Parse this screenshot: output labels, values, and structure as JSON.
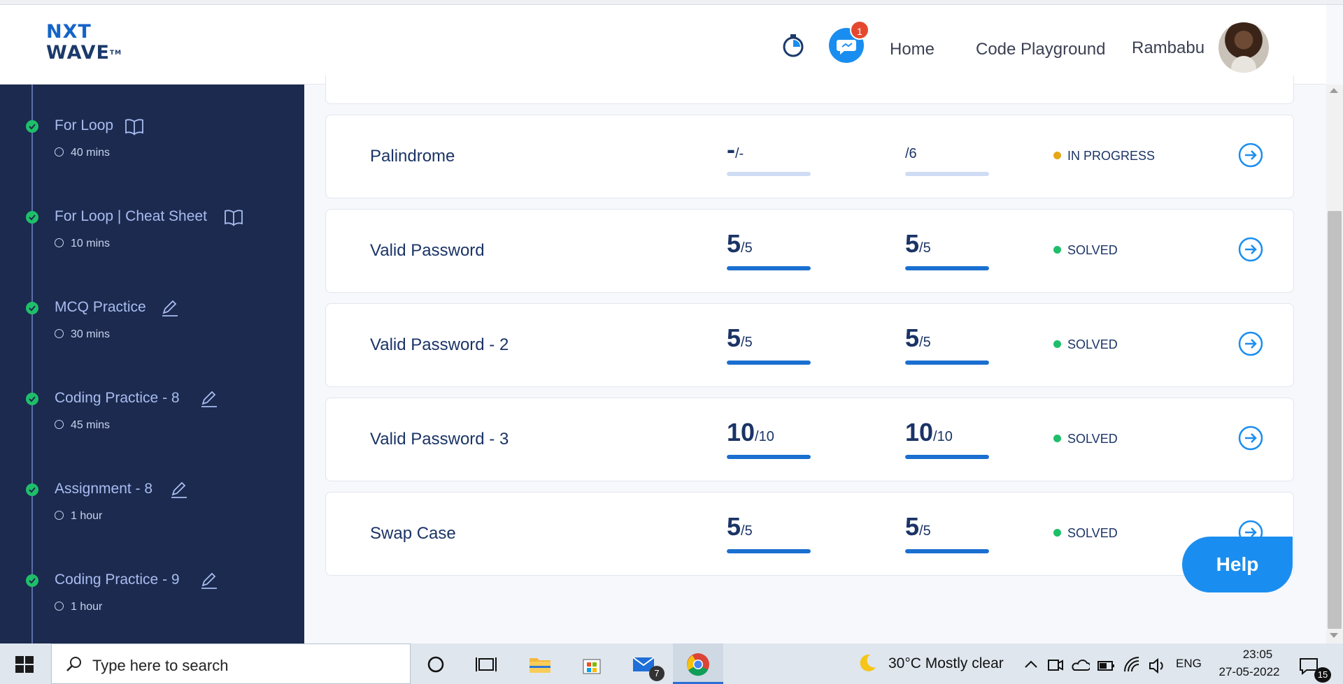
{
  "header": {
    "logo_line1": "NXT",
    "logo_line2": "WAVE",
    "logo_tm": "TM",
    "notification_count": "1",
    "nav_home": "Home",
    "nav_playground": "Code Playground",
    "user_name": "Rambabu"
  },
  "sidebar": {
    "items": [
      {
        "title": "For Loop",
        "duration": "40 mins",
        "icon": "book-icon"
      },
      {
        "title": "For Loop | Cheat Sheet",
        "duration": "10 mins",
        "icon": "book-icon"
      },
      {
        "title": "MCQ Practice",
        "duration": "30 mins",
        "icon": "pencil-icon"
      },
      {
        "title": "Coding Practice - 8",
        "duration": "45 mins",
        "icon": "pencil-icon"
      },
      {
        "title": "Assignment - 8",
        "duration": "1 hour",
        "icon": "pencil-icon"
      },
      {
        "title": "Coding Practice - 9",
        "duration": "1 hour",
        "icon": "pencil-icon"
      }
    ]
  },
  "questions": [
    {
      "title": "Palindrome",
      "score1_big": "-",
      "score1_small": "/-",
      "score1_fill": 0,
      "score2_big": "",
      "score2_small": "/6",
      "score2_fill": 0,
      "status": "IN PROGRESS",
      "status_color": "#e6a817"
    },
    {
      "title": "Valid Password",
      "score1_big": "5",
      "score1_small": "/5",
      "score1_fill": 1,
      "score2_big": "5",
      "score2_small": "/5",
      "score2_fill": 1,
      "status": "SOLVED",
      "status_color": "#1fbf6a"
    },
    {
      "title": "Valid Password - 2",
      "score1_big": "5",
      "score1_small": "/5",
      "score1_fill": 1,
      "score2_big": "5",
      "score2_small": "/5",
      "score2_fill": 1,
      "status": "SOLVED",
      "status_color": "#1fbf6a"
    },
    {
      "title": "Valid Password - 3",
      "score1_big": "10",
      "score1_small": "/10",
      "score1_fill": 1,
      "score2_big": "10",
      "score2_small": "/10",
      "score2_fill": 1,
      "status": "SOLVED",
      "status_color": "#1fbf6a"
    },
    {
      "title": "Swap Case",
      "score1_big": "5",
      "score1_small": "/5",
      "score1_fill": 1,
      "score2_big": "5",
      "score2_small": "/5",
      "score2_fill": 1,
      "status": "SOLVED",
      "status_color": "#1fbf6a"
    }
  ],
  "help_label": "Help",
  "taskbar": {
    "search_placeholder": "Type here to search",
    "mail_count": "7",
    "weather": "30°C  Mostly clear",
    "language": "ENG",
    "time": "23:05",
    "date": "27-05-2022",
    "notification_count": "15"
  },
  "colors": {
    "sidebar_bg": "#1b2a4e",
    "accent": "#1a8ef0",
    "solved": "#1fbf6a",
    "in_progress": "#e6a817",
    "primary_text": "#1b3466"
  }
}
